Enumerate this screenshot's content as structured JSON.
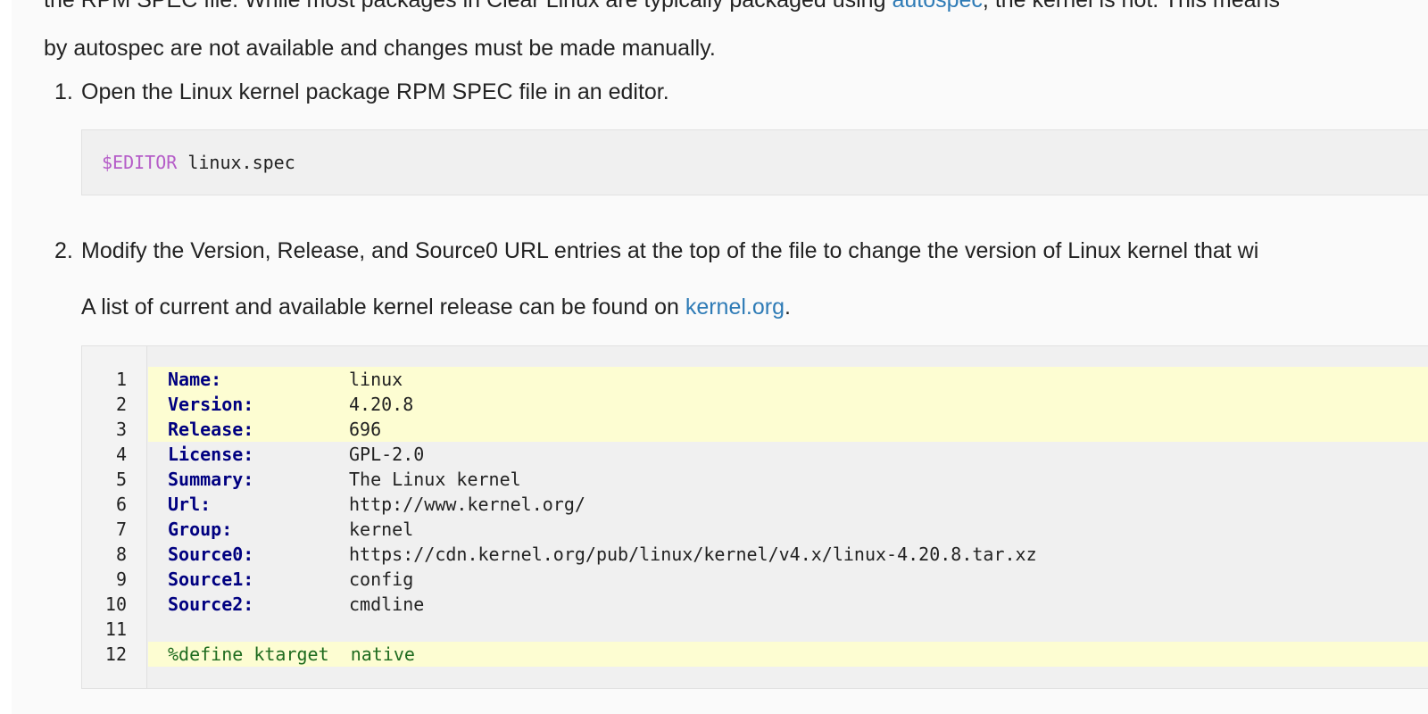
{
  "intro": {
    "line1_before": "the RPM SPEC file. While most packages in Clear Linux are typically packaged using ",
    "line1_link": "autospec",
    "line1_after": ", the kernel is not. This means",
    "line2": "by autospec are not available and changes must be made manually."
  },
  "steps": [
    {
      "number": "1.",
      "text": "Open the Linux kernel package RPM SPEC file in an editor."
    },
    {
      "number": "2.",
      "text": "Modify the Version, Release, and Source0 URL entries at the top of the file to change the version of Linux kernel that wi"
    }
  ],
  "note": {
    "before": "A list of current and available kernel release can be found on ",
    "link": "kernel.org",
    "after": "."
  },
  "code_block_1": {
    "variable": "$EDITOR",
    "argument": " linux.spec"
  },
  "code_block_2": {
    "line_numbers": [
      "1",
      "2",
      "3",
      "4",
      "5",
      "6",
      "7",
      "8",
      "9",
      "10",
      "11",
      "12"
    ],
    "lines": [
      {
        "key": "Name:",
        "value": "linux",
        "highlight": true
      },
      {
        "key": "Version:",
        "value": "4.20.8",
        "highlight": true
      },
      {
        "key": "Release:",
        "value": "696",
        "highlight": true
      },
      {
        "key": "License:",
        "value": "GPL-2.0",
        "highlight": false
      },
      {
        "key": "Summary:",
        "value": "The Linux kernel",
        "highlight": false
      },
      {
        "key": "Url:",
        "value": "http://www.kernel.org/",
        "highlight": false
      },
      {
        "key": "Group:",
        "value": "kernel",
        "highlight": false
      },
      {
        "key": "Source0:",
        "value": "https://cdn.kernel.org/pub/linux/kernel/v4.x/linux-4.20.8.tar.xz",
        "highlight": false
      },
      {
        "key": "Source1:",
        "value": "config",
        "highlight": false
      },
      {
        "key": "Source2:",
        "value": "cmdline",
        "highlight": false
      },
      {
        "key": "",
        "value": "",
        "highlight": false
      },
      {
        "macro": "%define ktarget  native",
        "highlight": true
      }
    ]
  },
  "colors": {
    "link": "#2e7bb6",
    "highlight": "#fdfdd2",
    "keyword": "#000080",
    "variable": "#b55cc8",
    "macro": "#1e6b1e"
  }
}
